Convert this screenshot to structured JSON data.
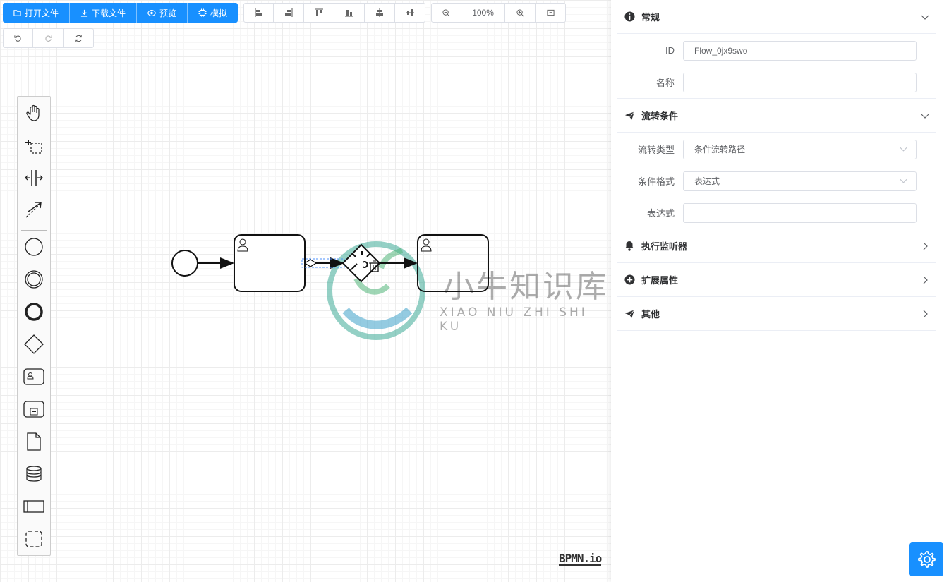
{
  "toolbar": {
    "open_file": "打开文件",
    "download_file": "下载文件",
    "preview": "预览",
    "simulate": "模拟",
    "zoom_level": "100%"
  },
  "canvas": {
    "watermark": "小牛知识库",
    "watermark_sub": "XIAO NIU ZHI SHI KU",
    "logo": "BPMN.io"
  },
  "panel": {
    "general": {
      "title": "常规",
      "id_label": "ID",
      "id_value": "Flow_0jx9swo",
      "name_label": "名称",
      "name_value": ""
    },
    "flow_condition": {
      "title": "流转条件",
      "type_label": "流转类型",
      "type_value": "条件流转路径",
      "format_label": "条件格式",
      "format_value": "表达式",
      "expr_label": "表达式",
      "expr_value": ""
    },
    "listeners": {
      "title": "执行监听器"
    },
    "extensions": {
      "title": "扩展属性"
    },
    "other": {
      "title": "其他"
    }
  },
  "colors": {
    "primary": "#1890ff",
    "selection": "#4d90fe"
  }
}
